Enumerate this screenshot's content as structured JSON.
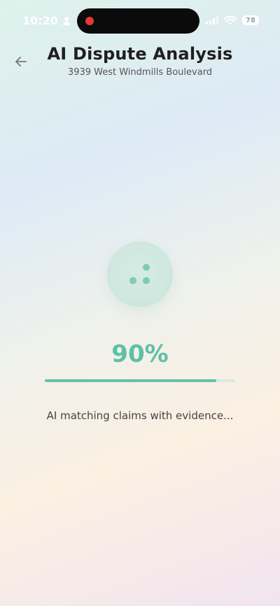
{
  "status_bar": {
    "time": "10:20",
    "battery": "78"
  },
  "header": {
    "title": "AI Dispute Analysis",
    "subtitle": "3939 West Windmills Boulevard"
  },
  "progress": {
    "percent_label": "90%",
    "value": 90,
    "message": "AI matching claims with evidence..."
  },
  "colors": {
    "accent": "#5fbfa6",
    "track": "#dbe8e3",
    "recording": "#e53935"
  },
  "icons": {
    "back": "arrow-left-icon",
    "loader": "loading-dots-icon",
    "user": "person-icon",
    "signal": "signal-icon",
    "wifi": "wifi-icon",
    "battery": "battery-icon"
  }
}
